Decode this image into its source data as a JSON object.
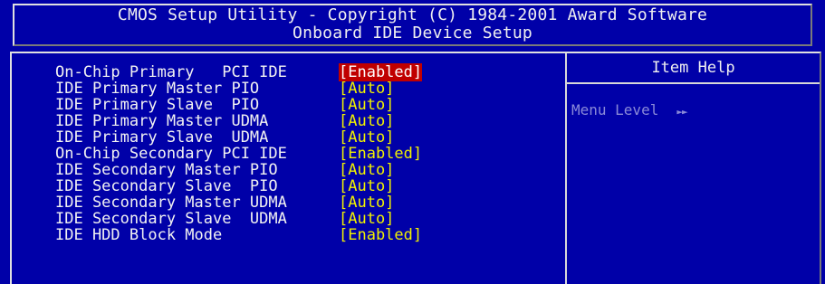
{
  "header": {
    "title": "CMOS Setup Utility - Copyright (C) 1984-2001 Award Software",
    "subtitle": "Onboard IDE Device Setup"
  },
  "settings": [
    {
      "label": "On-Chip Primary   PCI IDE",
      "value": "[Enabled]",
      "selected": true
    },
    {
      "label": "IDE Primary Master PIO",
      "value": "[Auto]"
    },
    {
      "label": "IDE Primary Slave  PIO",
      "value": "[Auto]"
    },
    {
      "label": "IDE Primary Master UDMA",
      "value": "[Auto]"
    },
    {
      "label": "IDE Primary Slave  UDMA",
      "value": "[Auto]"
    },
    {
      "label": "On-Chip Secondary PCI IDE",
      "value": "[Enabled]"
    },
    {
      "label": "IDE Secondary Master PIO",
      "value": "[Auto]"
    },
    {
      "label": "IDE Secondary Slave  PIO",
      "value": "[Auto]"
    },
    {
      "label": "IDE Secondary Master UDMA",
      "value": "[Auto]"
    },
    {
      "label": "IDE Secondary Slave  UDMA",
      "value": "[Auto]"
    },
    {
      "label": "IDE HDD Block Mode",
      "value": "[Enabled]"
    }
  ],
  "help": {
    "title": "Item Help",
    "menu_level_label": "Menu Level",
    "menu_level_arrows": "►►"
  },
  "colors": {
    "background": "#0000a8",
    "label_text": "#f2f2f2",
    "value_text": "#f0f000",
    "selected_bg": "#c00000",
    "help_text": "#8a8ad8"
  }
}
